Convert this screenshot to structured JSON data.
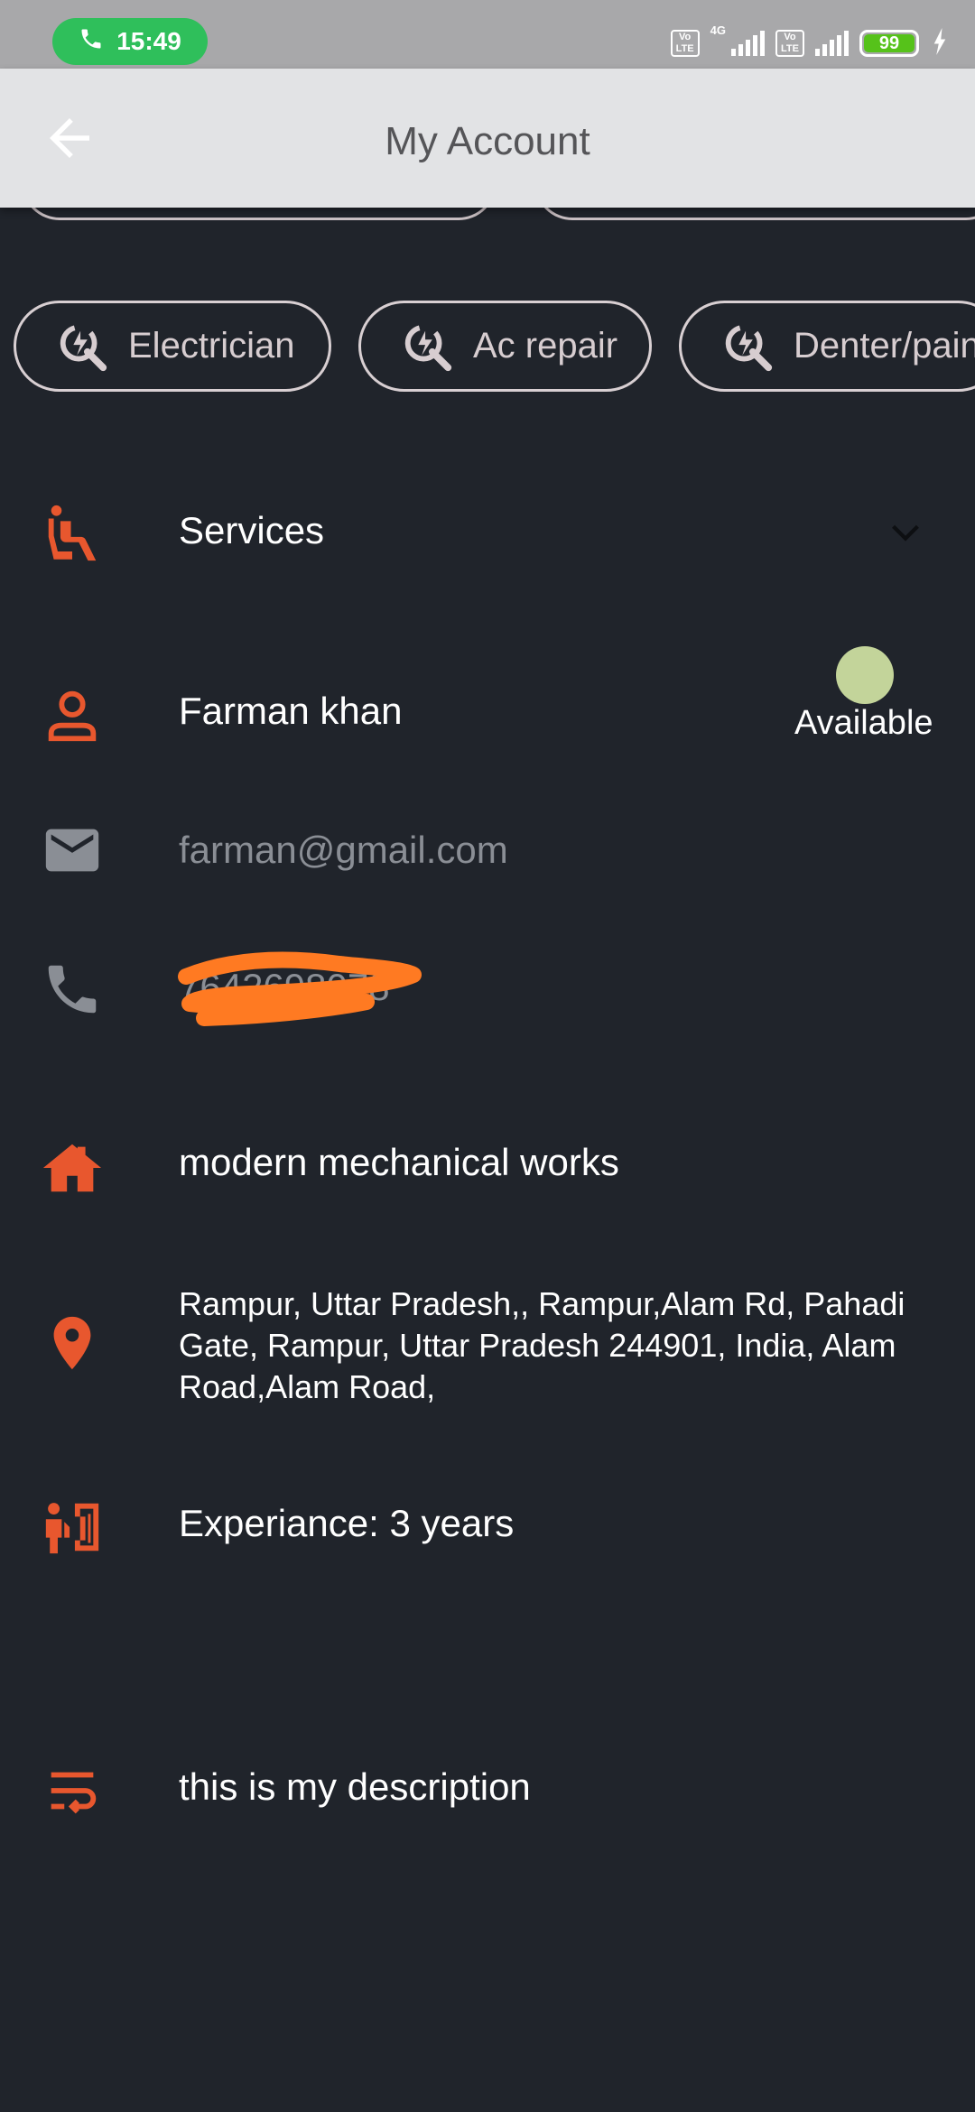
{
  "status_bar": {
    "time": "15:49",
    "network": "4G",
    "volte_label": "Vo LTE",
    "battery": "99"
  },
  "header": {
    "title": "My Account"
  },
  "chips": [
    {
      "label": "Electrician"
    },
    {
      "label": "Ac repair"
    },
    {
      "label": "Denter/pain"
    }
  ],
  "profile": {
    "services_label": "Services",
    "name": "Farman khan",
    "availability": "Available",
    "email": "farman@gmail.com",
    "phone": "7642698078",
    "shop": "modern mechanical works",
    "address": " Rampur, Uttar Pradesh,, Rampur,Alam Rd, Pahadi Gate, Rampur, Uttar Pradesh 244901, India, Alam Road,Alam Road,",
    "experience": "Experiance: 3 years",
    "description": "this is my description"
  },
  "colors": {
    "background": "#20242b",
    "accent": "#e8572e",
    "available_dot": "#c3d49a",
    "appbar": "#e2e3e5"
  },
  "icons": [
    "phone-call-icon",
    "back-arrow-icon",
    "wrench-bolt-icon",
    "seat-icon",
    "person-icon",
    "email-icon",
    "phone-icon",
    "home-icon",
    "location-pin-icon",
    "worker-icon",
    "description-icon",
    "chevron-down-icon"
  ]
}
